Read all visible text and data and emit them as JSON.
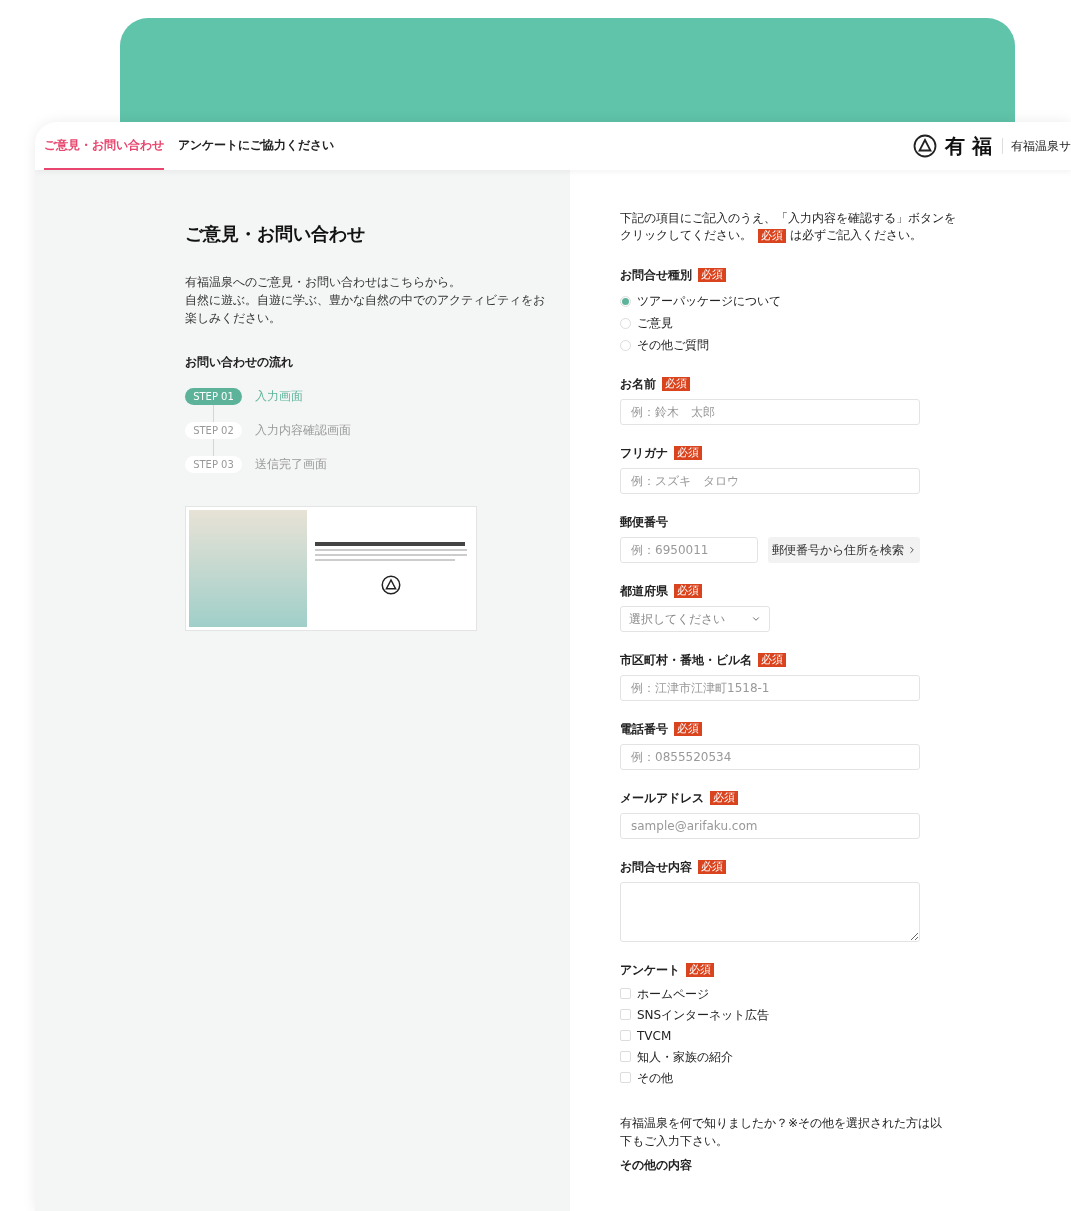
{
  "header": {
    "tabs": [
      {
        "label": "ご意見・お問い合わせ",
        "selected": true
      },
      {
        "label": "アンケートにご協力ください",
        "selected": false
      }
    ],
    "logo_text": "有 福",
    "site_link": "有福温泉サ"
  },
  "intro": {
    "title": "ご意見・お問い合わせ",
    "lines": [
      "有福温泉へのご意見・お問い合わせはこちらから。",
      "自然に遊ぶ。自遊に学ぶ、豊かな自然の中でのアクティビティをお楽しみください。"
    ],
    "flow_title": "お問い合わせの流れ",
    "steps": [
      {
        "badge": "STEP 01",
        "label": "入力画面",
        "selected": true
      },
      {
        "badge": "STEP 02",
        "label": "入力内容確認画面",
        "selected": false
      },
      {
        "badge": "STEP 03",
        "label": "送信完了画面",
        "selected": false
      }
    ]
  },
  "form": {
    "instructions_1": "下記の項目にご記入のうえ、「入力内容を確認する」ボタンを",
    "instructions_2a": "クリックしてください。",
    "required_badge": "必須",
    "instructions_2b": "は必ずご記入ください。",
    "fields": [
      {
        "kind": "radio",
        "label": "お問合せ種別",
        "badge": "必須",
        "options": [
          {
            "label": "ツアーパッケージについて",
            "selected": true
          },
          {
            "label": "ご意見",
            "selected": false
          },
          {
            "label": "その他ご質問",
            "selected": false
          }
        ]
      },
      {
        "kind": "text",
        "label": "お名前",
        "badge": "必須",
        "placeholder": "例：鈴木　太郎"
      },
      {
        "kind": "text",
        "label": "フリガナ",
        "badge": "必須",
        "placeholder": "例：スズキ　タロウ"
      },
      {
        "kind": "postal",
        "label": "郵便番号",
        "placeholder": "例：6950011",
        "button": "郵便番号から住所を検索"
      },
      {
        "kind": "select",
        "label": "都道府県",
        "badge": "必須",
        "placeholder": "選択してください"
      },
      {
        "kind": "text",
        "label": "市区町村・番地・ビル名",
        "badge": "必須",
        "placeholder": "例：江津市江津町1518-1"
      },
      {
        "kind": "text",
        "label": "電話番号",
        "badge": "必須",
        "placeholder": "例：0855520534"
      },
      {
        "kind": "text",
        "label": "メールアドレス",
        "badge": "必須",
        "placeholder": "sample@arifaku.com"
      },
      {
        "kind": "textarea",
        "label": "お問合せ内容",
        "badge": "必須"
      },
      {
        "kind": "checkbox",
        "label": "アンケート",
        "badge": "必須",
        "options": [
          {
            "label": "ホームページ",
            "checked": false
          },
          {
            "label": "SNSインターネット広告",
            "checked": false
          },
          {
            "label": "TVCM",
            "checked": false
          },
          {
            "label": "知人・家族の紹介",
            "checked": false
          },
          {
            "label": "その他",
            "checked": false
          }
        ]
      }
    ],
    "survey_note": "有福温泉を何で知りましたか？※その他を選択された方は以下もご入力下さい。",
    "other_label": "その他の内容"
  }
}
